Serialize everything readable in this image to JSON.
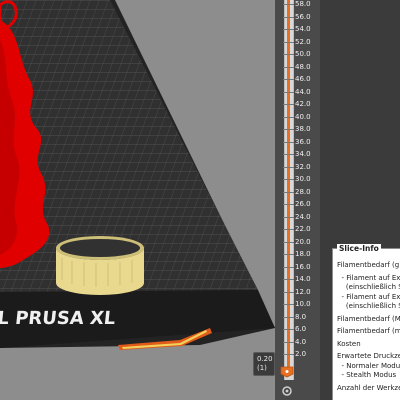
{
  "bed": {
    "label": "NAL PRUSA XL"
  },
  "layer_slider": {
    "ticks": [
      "58.0",
      "56.0",
      "54.0",
      "52.0",
      "50.0",
      "48.0",
      "46.0",
      "44.0",
      "42.0",
      "40.0",
      "38.0",
      "36.0",
      "34.0",
      "32.0",
      "30.0",
      "28.0",
      "26.0",
      "24.0",
      "22.0",
      "20.0",
      "18.0",
      "16.0",
      "14.0",
      "12.0",
      "10.0",
      "8.0",
      "6.0",
      "4.0",
      "2.0"
    ],
    "bottom_height": "0.20",
    "bottom_layer": "(1)"
  },
  "slice_info": {
    "title": "Slice-Info",
    "lines": [
      "Filamentbedarf (g):",
      "  - Filament auf Ex",
      "    (einschließlich S",
      "  - Filament auf Ex",
      "    (einschließlich S",
      "Filamentbedarf (Me",
      "Filamentbedarf (mm",
      "Kosten",
      "Erwartete Druckzeit",
      "  - Normaler Modus",
      "  - Stealth Modus",
      "Anzahl der Werkzeu"
    ]
  },
  "colors": {
    "model_red": "#e00000",
    "ring_yellow": "#e9d98f",
    "accent_orange": "#e87022",
    "bed_dark": "#262626",
    "background": "#8a8a8a"
  }
}
